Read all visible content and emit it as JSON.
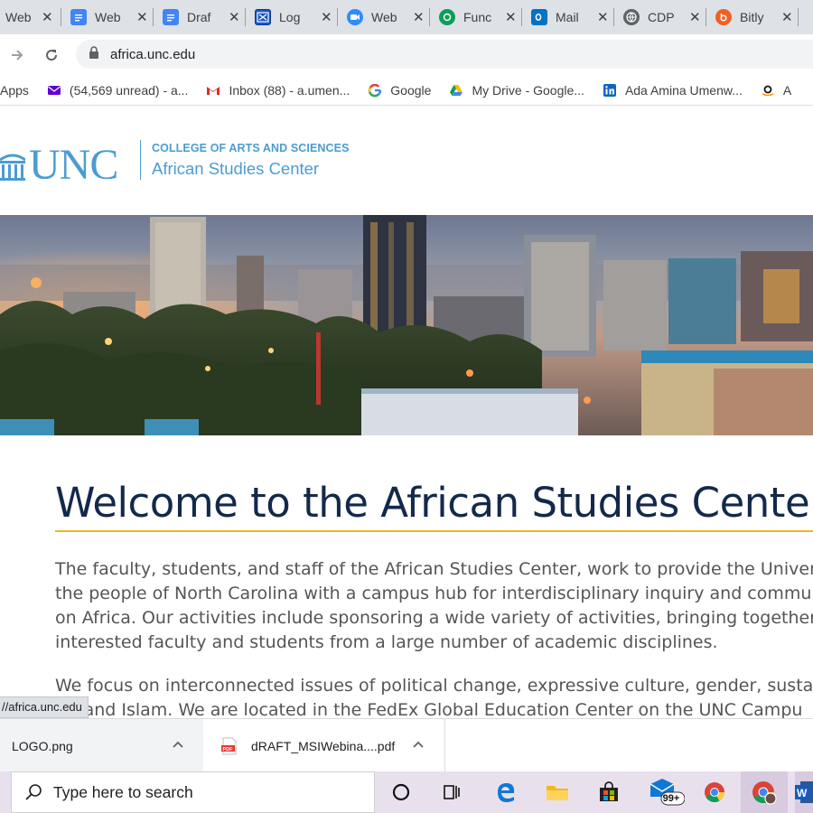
{
  "tabs": [
    {
      "title": "Web",
      "icon": "globe-icon",
      "color": "#5f6368"
    },
    {
      "title": "Web",
      "icon": "docs-icon",
      "color": "#4285f4"
    },
    {
      "title": "Draf",
      "icon": "docs-icon",
      "color": "#4285f4"
    },
    {
      "title": "Log",
      "icon": "ex-icon",
      "color": "#1a56c4"
    },
    {
      "title": "Web",
      "icon": "zoom-icon",
      "color": "#2d8cff"
    },
    {
      "title": "Func",
      "icon": "sheets-icon",
      "color": "#0f9d58"
    },
    {
      "title": "Mail",
      "icon": "outlook-icon",
      "color": "#0072c6"
    },
    {
      "title": "CDP",
      "icon": "globe-icon",
      "color": "#5f6368"
    },
    {
      "title": "Bitly",
      "icon": "bitly-icon",
      "color": "#ee6123"
    }
  ],
  "tab_close_glyph": "✕",
  "address": {
    "url": "africa.unc.edu"
  },
  "bookmarks": [
    {
      "label": "Apps",
      "icon": "apps-grid-icon"
    },
    {
      "label": "(54,569 unread) - a...",
      "icon": "yahoo-mail-icon"
    },
    {
      "label": "Inbox (88) - a.umen...",
      "icon": "gmail-icon"
    },
    {
      "label": "Google",
      "icon": "google-icon"
    },
    {
      "label": "My Drive - Google...",
      "icon": "drive-icon"
    },
    {
      "label": "Ada Amina Umenw...",
      "icon": "linkedin-icon"
    },
    {
      "label": "A",
      "icon": "amazon-icon"
    }
  ],
  "site": {
    "logo_text": "UNC",
    "college": "COLLEGE OF ARTS AND SCIENCES",
    "center": "African Studies Center"
  },
  "content": {
    "heading": "Welcome to the African Studies Center",
    "p1": [
      "The faculty, students, and staff of the African Studies Center, work to provide the University",
      "the people of North Carolina with a campus hub for interdisciplinary inquiry and communica",
      "on Africa. Our activities include sponsoring a wide variety of activities, bringing together",
      "interested faculty and students from a large number of academic disciplines."
    ],
    "p2": [
      "We focus on interconnected issues of political change, expressive culture, gender, sustaina",
      "th, and Islam. We are located in the FedEx Global Education Center on the UNC Campu"
    ]
  },
  "status_url": "//africa.unc.edu",
  "downloads": [
    {
      "name": "LOGO.png",
      "icon": "image-file-icon"
    },
    {
      "name": "dRAFT_MSIWebina....pdf",
      "icon": "pdf-icon"
    }
  ],
  "taskbar": {
    "search_placeholder": "Type here to search",
    "badge": "99+"
  },
  "colors": {
    "unc_blue": "#4b9cd3",
    "navy": "#13294b",
    "gold": "#f2b617"
  }
}
